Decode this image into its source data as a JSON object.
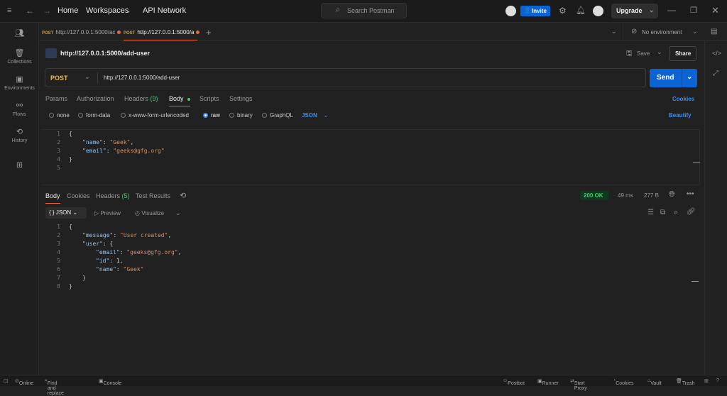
{
  "topbar": {
    "home": "Home",
    "workspaces": "Workspaces",
    "api_network": "API Network",
    "search_placeholder": "Search Postman",
    "invite": "Invite",
    "upgrade": "Upgrade"
  },
  "sidebar": {
    "items": [
      {
        "label": "Collections"
      },
      {
        "label": "Environments"
      },
      {
        "label": "Flows"
      },
      {
        "label": "History"
      }
    ]
  },
  "tabs": [
    {
      "method": "POST",
      "url": "http://127.0.0.1:5000/ac"
    },
    {
      "method": "POST",
      "url": "http://127.0.0.1:5000/a"
    }
  ],
  "environment": "No environment",
  "request": {
    "title": "http://127.0.0.1:5000/add-user",
    "save": "Save",
    "share": "Share",
    "method": "POST",
    "url": "http://127.0.0.1:5000/add-user",
    "send": "Send",
    "tabs": [
      "Params",
      "Authorization",
      "Headers",
      "Body",
      "Scripts",
      "Settings"
    ],
    "headers_count": "(9)",
    "cookies": "Cookies",
    "body_types": [
      "none",
      "form-data",
      "x-www-form-urlencoded",
      "raw",
      "binary",
      "GraphQL"
    ],
    "selected_body_type": "raw",
    "format": "JSON",
    "beautify": "Beautify",
    "body_lines": [
      [
        [
          "p",
          "{"
        ]
      ],
      [
        [
          "k",
          "\"name\""
        ],
        [
          "p",
          ": "
        ],
        [
          "s",
          "\"Geek\""
        ],
        [
          "p",
          ","
        ]
      ],
      [
        [
          "k",
          "\"email\""
        ],
        [
          "p",
          ": "
        ],
        [
          "s",
          "\"geeks@gfg.org\""
        ]
      ],
      [
        [
          "p",
          "}"
        ]
      ],
      []
    ],
    "body_indent": [
      0,
      1,
      1,
      0,
      0
    ]
  },
  "response": {
    "tabs": [
      "Body",
      "Cookies",
      "Headers",
      "Test Results"
    ],
    "headers_count": "(5)",
    "status": "200 OK",
    "time": "49 ms",
    "size": "277 B",
    "format": "JSON",
    "preview": "Preview",
    "visualize": "Visualize",
    "lines": [
      [
        [
          "p",
          "{"
        ]
      ],
      [
        [
          "k",
          "\"message\""
        ],
        [
          "p",
          ": "
        ],
        [
          "s",
          "\"User created\""
        ],
        [
          "p",
          ","
        ]
      ],
      [
        [
          "k",
          "\"user\""
        ],
        [
          "p",
          ": {"
        ]
      ],
      [
        [
          "k",
          "\"email\""
        ],
        [
          "p",
          ": "
        ],
        [
          "s",
          "\"geeks@gfg.org\""
        ],
        [
          "p",
          ","
        ]
      ],
      [
        [
          "k",
          "\"id\""
        ],
        [
          "p",
          ": "
        ],
        [
          "n",
          "1"
        ],
        [
          "p",
          ","
        ]
      ],
      [
        [
          "k",
          "\"name\""
        ],
        [
          "p",
          ": "
        ],
        [
          "s",
          "\"Geek\""
        ]
      ],
      [
        [
          "p",
          "}"
        ]
      ],
      [
        [
          "p",
          "}"
        ]
      ]
    ],
    "indent": [
      0,
      1,
      1,
      2,
      2,
      2,
      1,
      0
    ]
  },
  "statusbar": {
    "online": "Online",
    "find": "Find and replace",
    "console": "Console",
    "postbot": "Postbot",
    "runner": "Runner",
    "proxy": "Start Proxy",
    "cookies": "Cookies",
    "vault": "Vault",
    "trash": "Trash"
  },
  "colors": {
    "accent": "#e8683b",
    "primary": "#0c63d4",
    "success": "#4cc46f"
  }
}
